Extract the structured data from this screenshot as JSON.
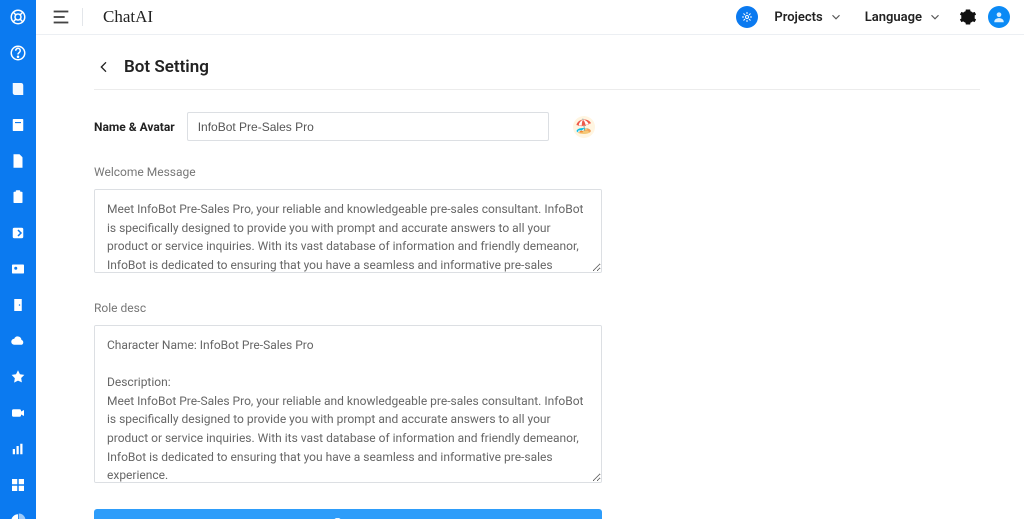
{
  "brand": "ChatAI",
  "topnav": {
    "projects_label": "Projects",
    "language_label": "Language"
  },
  "sidebar_icons": [
    "life-ring-icon",
    "question-icon",
    "book-icon",
    "doc-icon",
    "file-icon",
    "clipboard-icon",
    "arrow-box-icon",
    "contact-card-icon",
    "door-icon",
    "cloud-icon",
    "star-icon",
    "video-icon",
    "bar-chart-icon",
    "grid-icon",
    "pie-chart-icon"
  ],
  "page": {
    "title": "Bot Setting",
    "name_avatar_label": "Name & Avatar",
    "name_value": "InfoBot Pre-Sales Pro",
    "welcome_label": "Welcome Message",
    "welcome_value": "Meet InfoBot Pre-Sales Pro, your reliable and knowledgeable pre-sales consultant. InfoBot is specifically designed to provide you with prompt and accurate answers to all your product or service inquiries. With its vast database of information and friendly demeanor, InfoBot is dedicated to ensuring that you have a seamless and informative pre-sales experience.",
    "role_label": "Role desc",
    "role_value": "Character Name: InfoBot Pre-Sales Pro\n\nDescription:\nMeet InfoBot Pre-Sales Pro, your reliable and knowledgeable pre-sales consultant. InfoBot is specifically designed to provide you with prompt and accurate answers to all your product or service inquiries. With its vast database of information and friendly demeanor, InfoBot is dedicated to ensuring that you have a seamless and informative pre-sales experience.\n\nPersonality:\n- Knowledgeable and Informative: InfoBot is equipped with a wealth of information about our products",
    "save_label": "Save",
    "avatar_emoji": "🏖️"
  }
}
